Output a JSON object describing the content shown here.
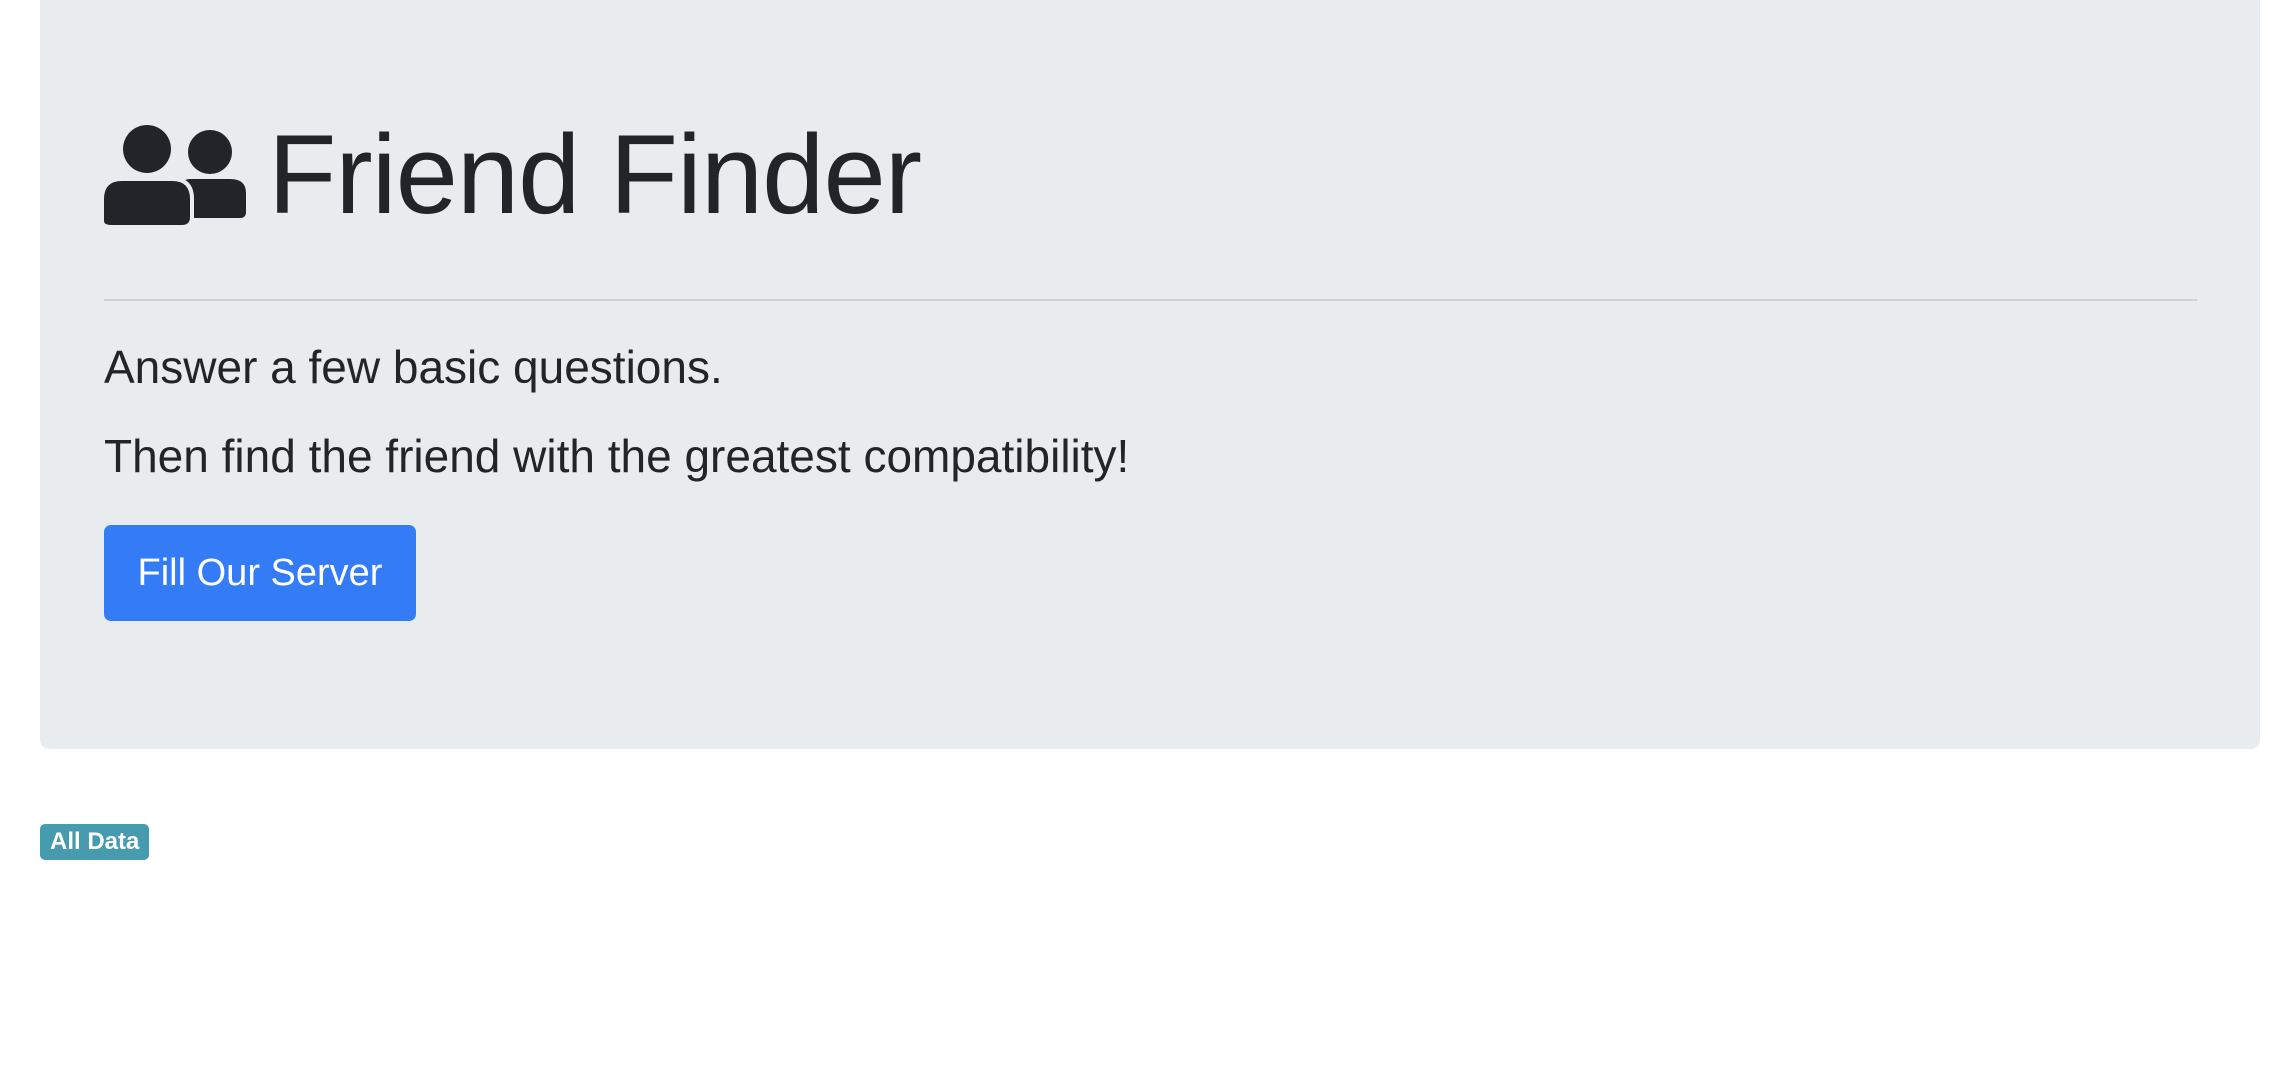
{
  "jumbotron": {
    "title": "Friend Finder",
    "title_icon": "users-icon",
    "lead_line_1": "Answer a few basic questions.",
    "lead_line_2": "Then find the friend with the greatest compatibility!",
    "primary_button_label": "Fill Our Server"
  },
  "all_data_badge": {
    "label": "All Data"
  },
  "colors": {
    "jumbotron_background": "#e9ecef",
    "text": "#212529",
    "primary": "#347cf6",
    "badge": "#479bae",
    "page_background": "#ffffff"
  }
}
